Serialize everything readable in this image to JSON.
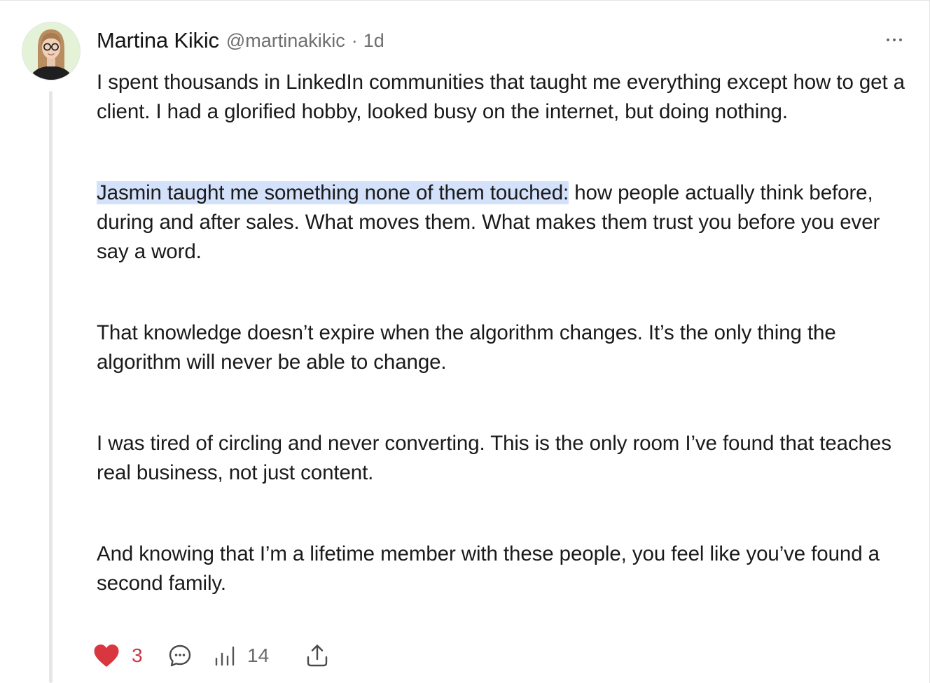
{
  "post": {
    "author": {
      "name": "Martina Kikic",
      "handle": "@martinakikic"
    },
    "separator": "·",
    "time": "1d",
    "paragraphs": [
      {
        "highlight": "",
        "text": "I spent thousands in LinkedIn communities that taught me everything except how to get a client. I had a glorified hobby, looked busy on the internet, but doing nothing."
      },
      {
        "highlight": "Jasmin taught me something none of them touched:",
        "text": " how people actually think before, during and after sales. What moves them. What makes them trust you before you ever say a word."
      },
      {
        "highlight": "",
        "text": "That knowledge doesn’t expire when the algorithm changes. It’s the only thing the algorithm will never be able to change."
      },
      {
        "highlight": "",
        "text": "I was tired of circling and never converting. This is the only room I’ve found that teaches real business, not just content."
      },
      {
        "highlight": "",
        "text": "And knowing that I’m a lifetime member with these people, you feel like you’ve found a second family."
      }
    ],
    "stats": {
      "likes": "3",
      "views": "14"
    },
    "icons": {
      "like": "heart-icon",
      "reply": "comment-bubble-icon",
      "views": "bar-chart-icon",
      "share": "share-upload-icon",
      "more": "more-dots-icon"
    },
    "colors": {
      "like": "#d9373f",
      "highlight": "#d3e1fb",
      "muted": "#6f6f6f"
    }
  }
}
